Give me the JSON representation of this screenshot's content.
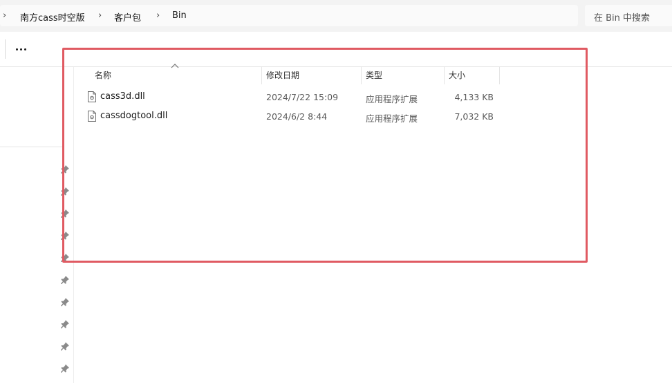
{
  "breadcrumb": {
    "items": [
      "南方cass时空版",
      "客户包",
      "Bin"
    ]
  },
  "search": {
    "placeholder": "在 Bin 中搜索"
  },
  "toolbar": {
    "more_label": "..."
  },
  "columns": [
    "名称",
    "修改日期",
    "类型",
    "大小"
  ],
  "files": [
    {
      "name": "cass3d.dll",
      "date": "2024/7/22 15:09",
      "type": "应用程序扩展",
      "size": "4,133 KB"
    },
    {
      "name": "cassdogtool.dll",
      "date": "2024/6/2 8:44",
      "type": "应用程序扩展",
      "size": "7,032 KB"
    }
  ],
  "colors": {
    "highlight": "#e05a62",
    "pin": "#8a8a8a"
  }
}
